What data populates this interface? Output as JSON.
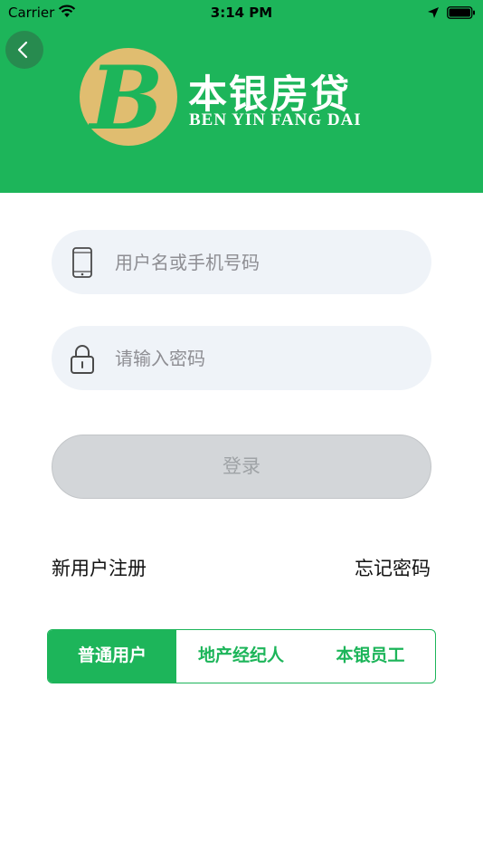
{
  "status_bar": {
    "carrier": "Carrier",
    "time": "3:14 PM"
  },
  "brand": {
    "name_cn": "本银房贷",
    "name_en": "BEN YIN FANG DAI",
    "logo_letter": "B",
    "green": "#1db55a",
    "gold": "#e0bd70"
  },
  "form": {
    "username_placeholder": "用户名或手机号码",
    "password_placeholder": "请输入密码",
    "login_label": "登录"
  },
  "links": {
    "register": "新用户注册",
    "forgot": "忘记密码"
  },
  "user_types": [
    {
      "label": "普通用户",
      "active": true
    },
    {
      "label": "地产经纪人",
      "active": false
    },
    {
      "label": "本银员工",
      "active": false
    }
  ],
  "icons": {
    "back": "chevron-left-icon",
    "phone": "phone-icon",
    "lock": "lock-icon",
    "wifi": "wifi-icon",
    "location": "location-arrow-icon",
    "battery": "battery-icon"
  }
}
